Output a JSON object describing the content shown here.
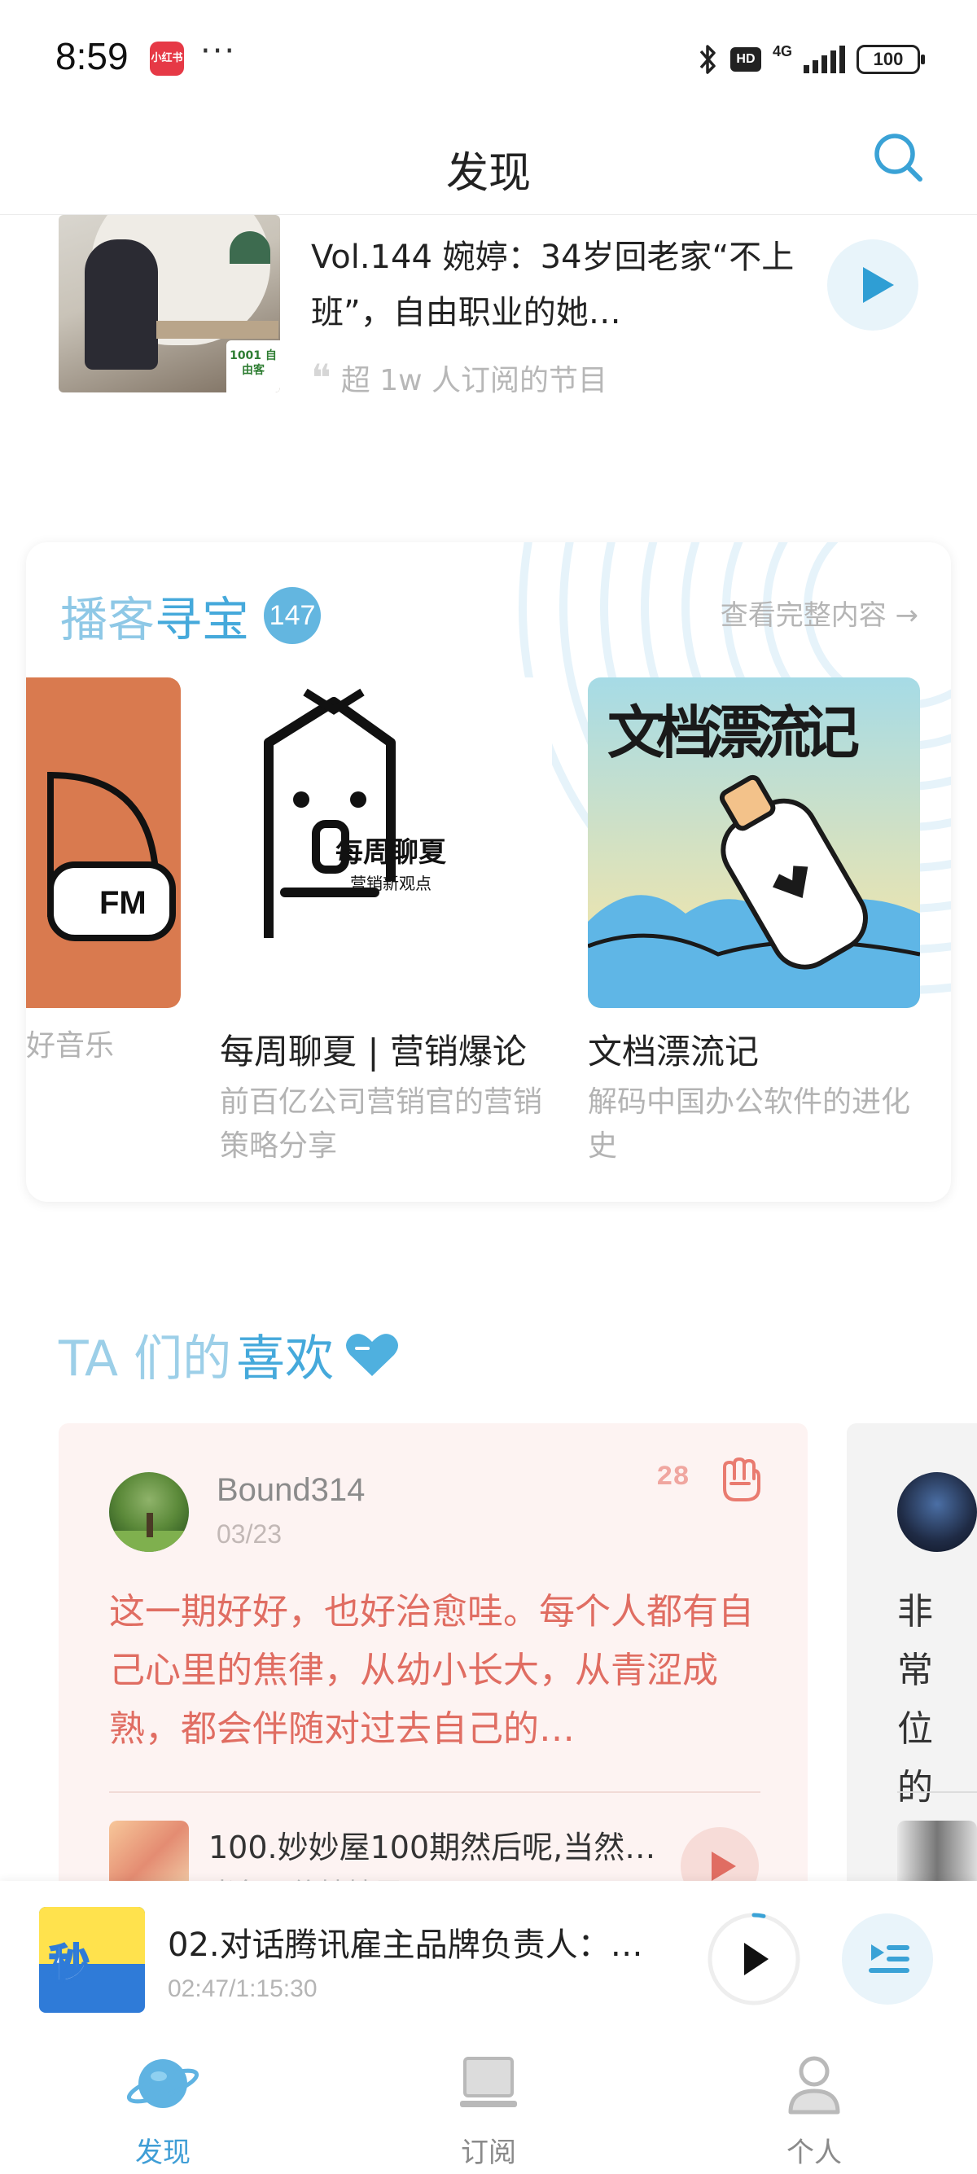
{
  "status_bar": {
    "time": "8:59",
    "app_badge": "小红书",
    "more": "···",
    "hd": "HD",
    "network": "4G",
    "battery": "100"
  },
  "header": {
    "title": "发现"
  },
  "featured": {
    "title": "Vol.144 婉婷：34岁回老家“不上班”，自由职业的她…",
    "subtitle": "超 1w 人订阅的节目",
    "cover_badge": "1001 自由客"
  },
  "treasure": {
    "title_part1": "播客",
    "title_part2": "寻宝",
    "count": "147",
    "view_all": "查看完整内容 →",
    "podcasts": [
      {
        "title": "",
        "desc": "好音乐",
        "cover_text": "FM"
      },
      {
        "title": "每周聊夏 | 营销爆论",
        "desc": "前百亿公司营销官的营销策略分享",
        "cover_text": "每周聊夏",
        "cover_sub": "营销新观点"
      },
      {
        "title": "文档漂流记",
        "desc": "解码中国办公软件的进化史",
        "cover_text": "文档漂流记"
      }
    ]
  },
  "ta_section": {
    "title_part1": "TA 们的",
    "title_part2": "喜欢",
    "cards": [
      {
        "user": "Bound314",
        "date": "03/23",
        "likes": "28",
        "comment": "这一期好好，也好治愈哇。每个人都有自己心里的焦律，从幼小长大，从青涩成熟，都会伴随对过去自己的…",
        "episode_title": "100.妙妙屋100期然后呢,当然…",
        "episode_sub": "光兔二傻妙妙屋"
      },
      {
        "comment": "非常位的羞耻"
      }
    ]
  },
  "now_playing": {
    "title": "02.对话腾讯雇主品牌负责人：…",
    "time": "02:47/1:15:30",
    "cover_text": "秒"
  },
  "bottom_nav": {
    "items": [
      {
        "label": "发现",
        "icon": "planet-icon",
        "active": true
      },
      {
        "label": "订阅",
        "icon": "laptop-icon",
        "active": false
      },
      {
        "label": "个人",
        "icon": "person-icon",
        "active": false
      }
    ]
  },
  "colors": {
    "accent": "#45a9db",
    "accent_light": "#8ec8e6",
    "comment_red": "#e06d62",
    "card_pink": "#fdf3f2"
  }
}
